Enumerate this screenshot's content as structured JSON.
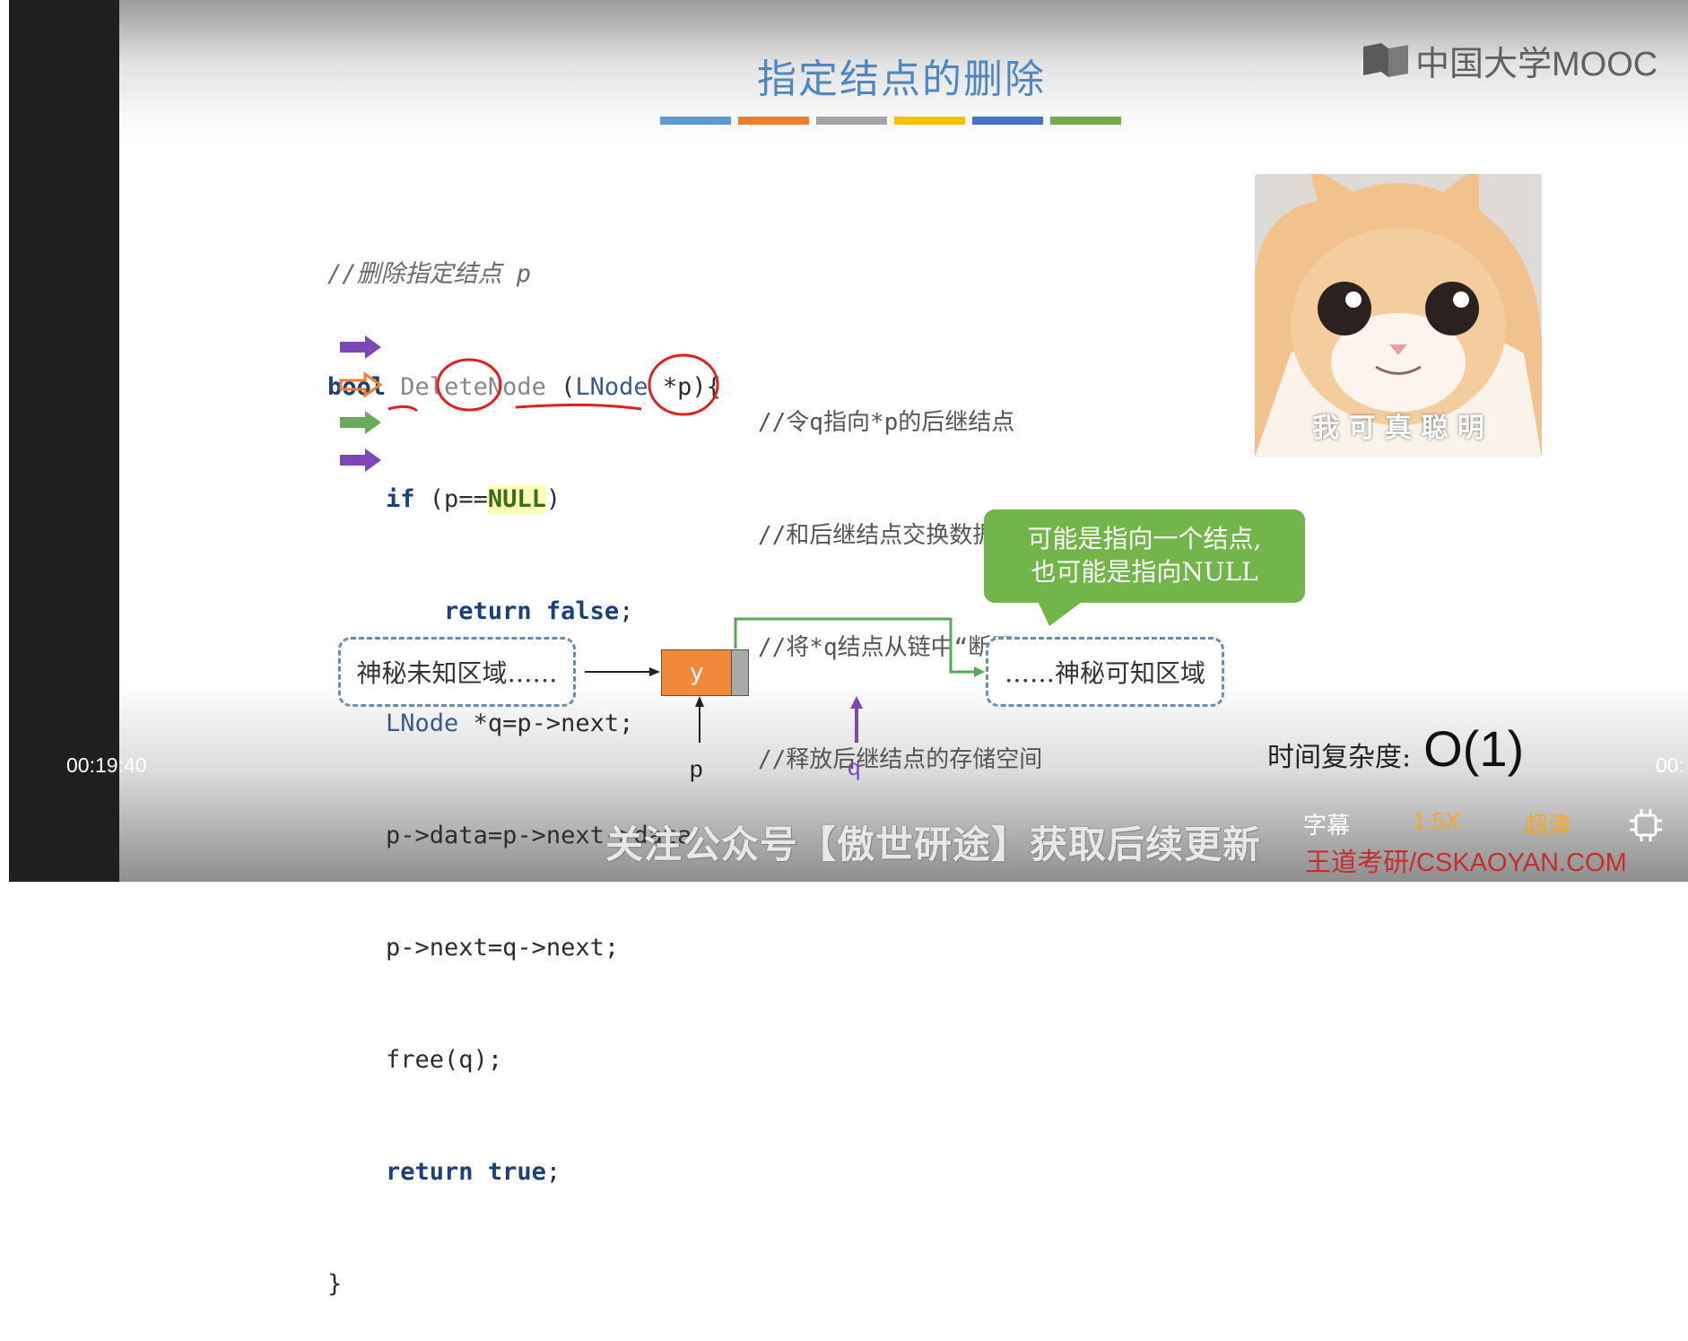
{
  "slide": {
    "title": "指定结点的删除",
    "logo_text": "中国大学MOOC",
    "color_strip": [
      "#5b9bd5",
      "#ed7d31",
      "#a5a5a5",
      "#ffc000",
      "#4472c4",
      "#70ad47"
    ]
  },
  "code": {
    "comment_head": "//删除指定结点 p",
    "sig_kw": "bool",
    "sig_fn": "DeleteNode",
    "sig_type": "LNode",
    "sig_rest": " *p){",
    "if_kw": "if",
    "if_open": " (p==",
    "if_null": "NULL",
    "if_close": ")",
    "return_kw": "return",
    "false_kw": "false",
    "semicolon": ";",
    "line_q_type": "LNode",
    "line_q": " *q=p->next;",
    "line_data": "p->data=p->next->data",
    "line_link": "p->next=q->next;",
    "line_free": "free(q);",
    "return_true_kw": "return",
    "true_kw": "true",
    "close_brace": "}",
    "comments": [
      "//令q指向*p的后继结点",
      "//和后继结点交换数据域",
      "//将*q结点从链中“断开”",
      "//释放后继结点的存储空间"
    ]
  },
  "image": {
    "caption": "我 可 真 聪 明",
    "icon": "smug-cat-meme"
  },
  "diagram": {
    "callout_line1": "可能是指向一个结点,",
    "callout_line2": "也可能是指向NULL",
    "unknown_region": "神秘未知区域……",
    "known_region": "……神秘可知区域",
    "node_value": "y",
    "pointer_p": "p",
    "pointer_q": "q"
  },
  "complexity": {
    "label": "时间复杂度:",
    "value": "O(1)"
  },
  "player": {
    "time_left": "00:19:40",
    "time_right": "00:",
    "subtitle_text": "关注公众号【傲世研途】获取后续更新",
    "captions_label": "字幕",
    "speed_label": "1.5X",
    "quality_label": "超清",
    "brand_watermark": "王道考研/CSKAOYAN.COM",
    "accent_orange": "#f5a623"
  }
}
